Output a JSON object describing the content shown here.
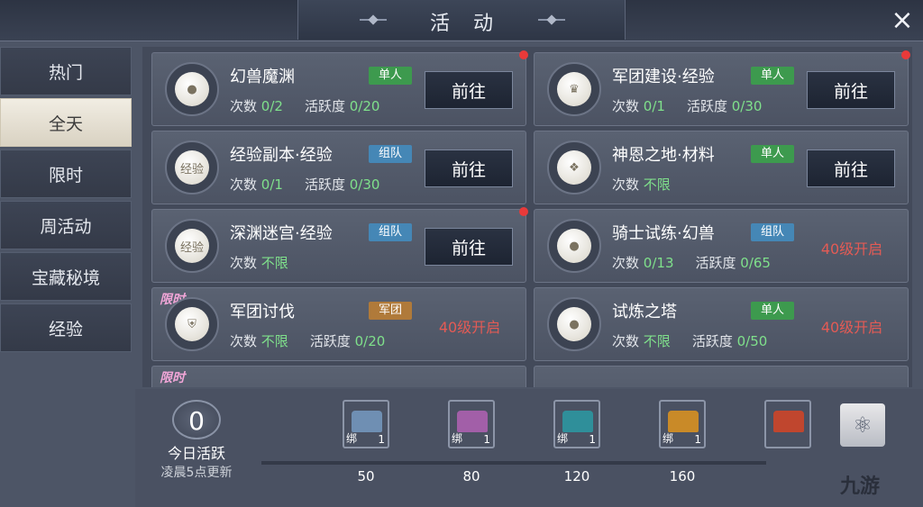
{
  "window": {
    "title": "活动",
    "close_icon": "×"
  },
  "sidebar": {
    "items": [
      {
        "label": "热门",
        "active": false
      },
      {
        "label": "全天",
        "active": true
      },
      {
        "label": "限时",
        "active": false
      },
      {
        "label": "周活动",
        "active": false
      },
      {
        "label": "宝藏秘境",
        "active": false
      },
      {
        "label": "经验",
        "active": false
      }
    ]
  },
  "activities": [
    {
      "name": "幻兽魔渊",
      "tag": "单人",
      "count_label": "次数",
      "count": "0/2",
      "activity_label": "活跃度",
      "activity": "0/20",
      "action": "前往",
      "red_dot": true,
      "icon": "egg-icon"
    },
    {
      "name": "军团建设·经验",
      "tag": "单人",
      "count_label": "次数",
      "count": "0/1",
      "activity_label": "活跃度",
      "activity": "0/30",
      "action": "前往",
      "red_dot": true,
      "icon": "crest-icon"
    },
    {
      "name": "经验副本·经验",
      "tag": "组队",
      "count_label": "次数",
      "count": "0/1",
      "activity_label": "活跃度",
      "activity": "0/30",
      "action": "前往",
      "red_dot": false,
      "icon_text": "经验"
    },
    {
      "name": "神恩之地·材料",
      "tag": "单人",
      "count_label": "次数",
      "count": "不限",
      "action": "前往",
      "red_dot": false,
      "icon": "rune-stone-icon"
    },
    {
      "name": "深渊迷宫·经验",
      "tag": "组队",
      "count_label": "次数",
      "count": "不限",
      "action": "前往",
      "red_dot": true,
      "icon_text": "经验"
    },
    {
      "name": "骑士试练·幻兽",
      "tag": "组队",
      "count_label": "次数",
      "count": "0/13",
      "activity_label": "活跃度",
      "activity": "0/65",
      "lock": "40级开启",
      "icon": "egg-icon"
    },
    {
      "name": "军团讨伐",
      "tag": "军团",
      "count_label": "次数",
      "count": "不限",
      "activity_label": "活跃度",
      "activity": "0/20",
      "lock": "40级开启",
      "limited": "限时",
      "icon": "armor-icon"
    },
    {
      "name": "试炼之塔",
      "tag": "单人",
      "count_label": "次数",
      "count": "不限",
      "activity_label": "活跃度",
      "activity": "0/50",
      "lock": "40级开启",
      "icon": "egg-icon"
    }
  ],
  "partial_limited": "限时",
  "bottom": {
    "active_value": "0",
    "active_label": "今日活跃",
    "refresh_note": "凌晨5点更新",
    "rewards": [
      {
        "bind": "绑",
        "count": "1",
        "milestone": "50",
        "color": "#6f8fb3"
      },
      {
        "bind": "绑",
        "count": "1",
        "milestone": "80",
        "color": "#a25fa8"
      },
      {
        "bind": "绑",
        "count": "1",
        "milestone": "120",
        "color": "#2f8f9a"
      },
      {
        "bind": "绑",
        "count": "1",
        "milestone": "160",
        "color": "#c98a28"
      },
      {
        "color": "#c0462e"
      }
    ]
  },
  "watermark": "九游"
}
